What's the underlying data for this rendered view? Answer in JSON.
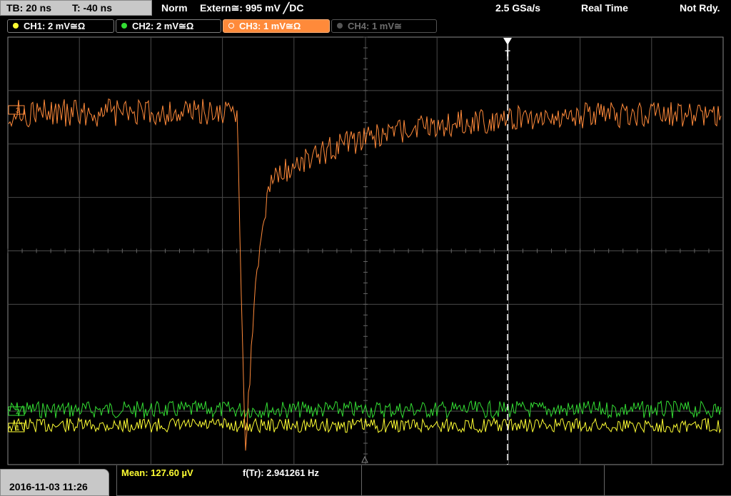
{
  "header": {
    "tb_label": "TB: 20 ns",
    "t_label": "T: -40 ns",
    "trigger_mode": "Norm",
    "trigger_source": "Extern≅: 995 mV ╱DC",
    "sample_rate": "2.5 GSa/s",
    "acq_mode": "Real Time",
    "status": "Not Rdy."
  },
  "channels": [
    {
      "label": "CH1: 2 mV≅Ω",
      "color": "#ffff33",
      "state": "on"
    },
    {
      "label": "CH2: 2 mV≅Ω",
      "color": "#33dd33",
      "state": "on"
    },
    {
      "label": "CH3: 1 mV≅Ω",
      "color": "#ff8a3a",
      "state": "active"
    },
    {
      "label": "CH4: 1 mV≅",
      "color": "#6e6e6e",
      "state": "off"
    }
  ],
  "markers": {
    "trigger": "T",
    "ch1_ref": "1",
    "ch2_ref": "2",
    "ch3_ref": "3"
  },
  "footer": {
    "datetime": "2016-11-03 11:26",
    "meas1": "Mean: 127.60 µV",
    "meas2": "f(Tr): 2.941261 Hz"
  },
  "colors": {
    "ch1": "#ffff33",
    "ch2": "#33dd33",
    "ch3": "#ff8a3a",
    "grid": "#5a5a5a",
    "background": "#000000"
  }
}
